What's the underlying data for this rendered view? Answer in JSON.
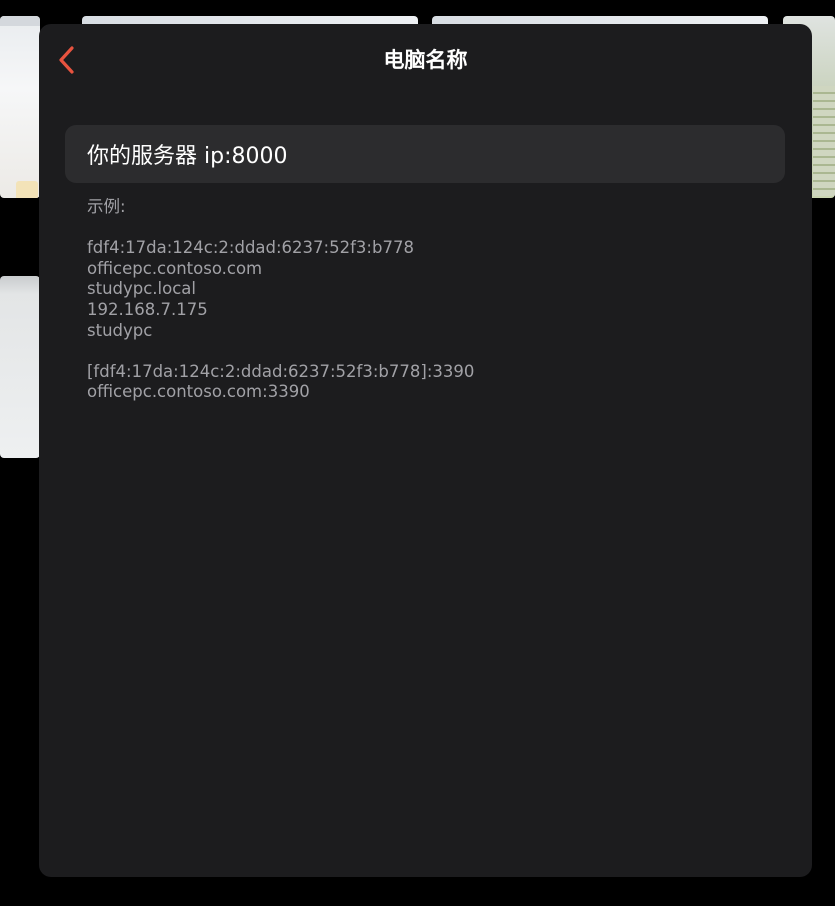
{
  "header": {
    "title": "电脑名称",
    "back_icon": "chevron-left-icon",
    "accent_color": "#e8533f"
  },
  "pc_name_input": {
    "placeholder": "你的服务器 ip:8000"
  },
  "examples": {
    "label": "示例:",
    "group1": [
      "fdf4:17da:124c:2:ddad:6237:52f3:b778",
      "officepc.contoso.com",
      "studypc.local",
      "192.168.7.175",
      "studypc"
    ],
    "group2": [
      "[fdf4:17da:124c:2:ddad:6237:52f3:b778]:3390",
      "officepc.contoso.com:3390"
    ]
  },
  "colors": {
    "sheet_background": "#1c1c1e",
    "input_background": "#2c2c2e",
    "help_text": "#a1a1a6"
  }
}
